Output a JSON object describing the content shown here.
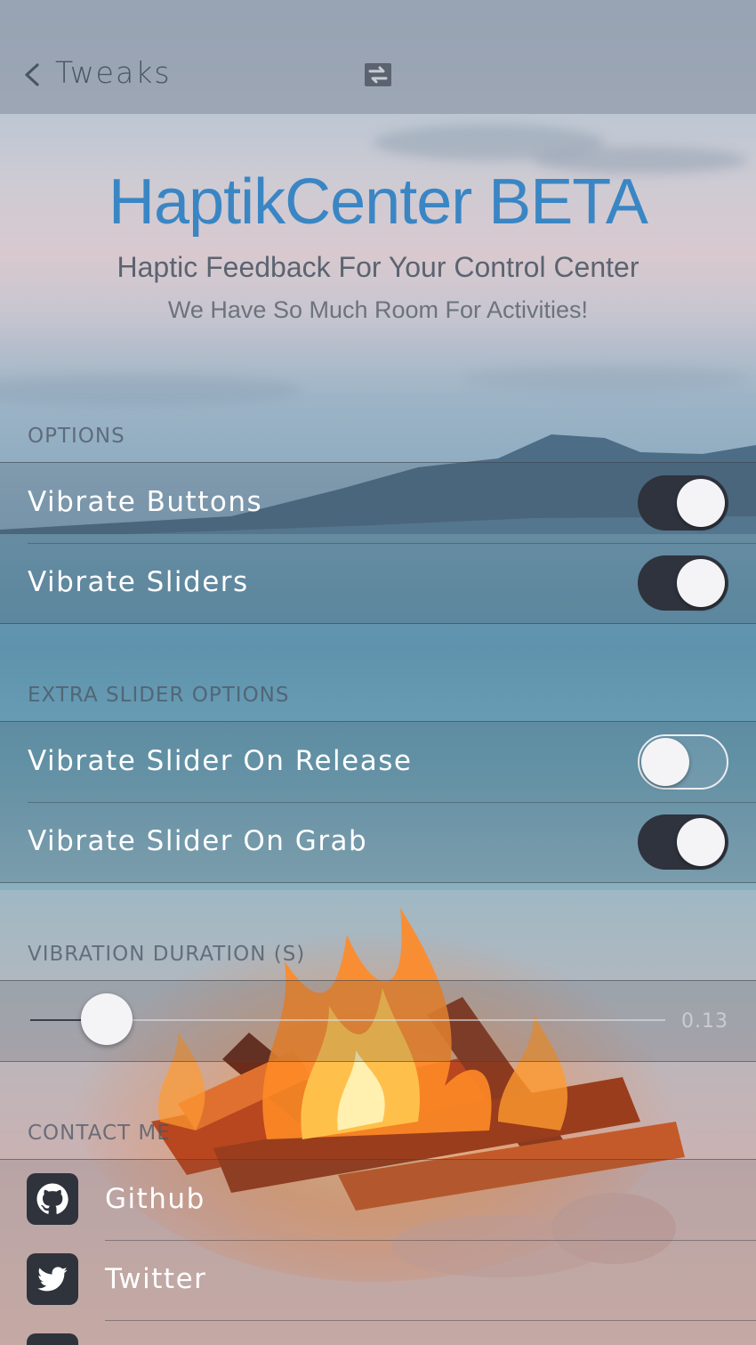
{
  "nav": {
    "back_label": "Tweaks",
    "center_icon": "refresh-icon"
  },
  "header": {
    "title": "HaptikCenter BETA",
    "subtitle": "Haptic Feedback For Your Control Center",
    "tagline": "We Have So Much Room For Activities!"
  },
  "options": {
    "header": "OPTIONS",
    "items": [
      {
        "label": "Vibrate Buttons",
        "enabled": true
      },
      {
        "label": "Vibrate Sliders",
        "enabled": true
      }
    ]
  },
  "extra": {
    "header": "EXTRA SLIDER OPTIONS",
    "items": [
      {
        "label": "Vibrate Slider On Release",
        "enabled": false
      },
      {
        "label": "Vibrate Slider On Grab",
        "enabled": true
      }
    ]
  },
  "duration": {
    "header": "VIBRATION DURATION (S)",
    "value_label": "0.13",
    "fraction": 0.12
  },
  "contact": {
    "header": "CONTACT ME",
    "items": [
      {
        "label": "Github",
        "icon": "github-icon"
      },
      {
        "label": "Twitter",
        "icon": "twitter-icon"
      }
    ]
  },
  "colors": {
    "title": "#3a86c4",
    "switch_on": "#2f333d",
    "knob": "#f4f4f6"
  }
}
